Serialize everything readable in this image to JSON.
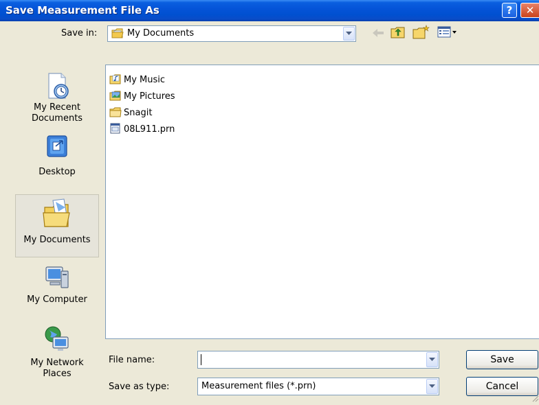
{
  "window": {
    "title": "Save Measurement File As"
  },
  "title_buttons": {
    "help": "?",
    "close": "✕"
  },
  "save_in": {
    "label": "Save in:",
    "value": "My Documents"
  },
  "places": [
    {
      "label": "My Recent Documents",
      "icon": "recent-documents-icon"
    },
    {
      "label": "Desktop",
      "icon": "desktop-icon"
    },
    {
      "label": "My Documents",
      "icon": "my-documents-icon",
      "selected": true
    },
    {
      "label": "My Computer",
      "icon": "computer-icon"
    },
    {
      "label": "My Network Places",
      "icon": "network-icon"
    }
  ],
  "files": [
    {
      "name": "My Music",
      "icon": "music-folder-icon"
    },
    {
      "name": "My Pictures",
      "icon": "pictures-folder-icon"
    },
    {
      "name": "Snagit",
      "icon": "folder-icon"
    },
    {
      "name": "08L911.prn",
      "icon": "prn-file-icon"
    }
  ],
  "file_name": {
    "label": "File name:",
    "value": ""
  },
  "save_as_type": {
    "label": "Save as type:",
    "value": "Measurement files (*.prn)"
  },
  "buttons": {
    "save": "Save",
    "cancel": "Cancel"
  }
}
